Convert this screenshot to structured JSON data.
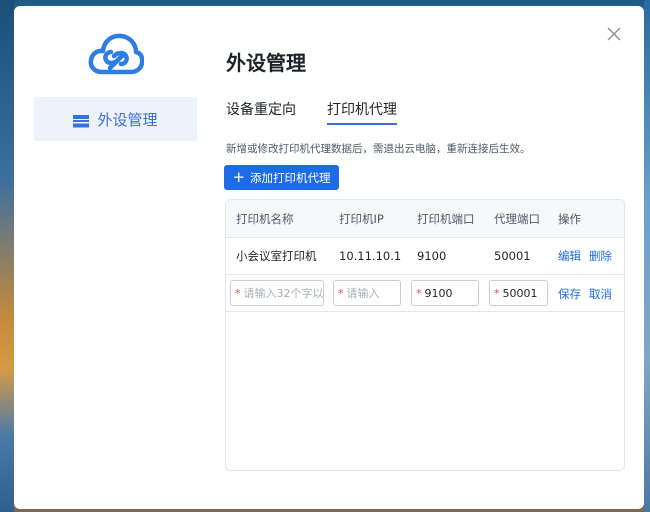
{
  "sidebar": {
    "items": [
      {
        "label": "外设管理",
        "icon": "printer-device-icon"
      }
    ]
  },
  "main": {
    "title": "外设管理",
    "tabs": [
      {
        "label": "设备重定向"
      },
      {
        "label": "打印机代理",
        "active": true
      }
    ],
    "hint": "新增或修改打印机代理数据后，需退出云电脑，重新连接后生效。",
    "add_button": "添加打印机代理"
  },
  "table": {
    "columns": [
      "打印机名称",
      "打印机IP",
      "打印机端口",
      "代理端口",
      "操作"
    ],
    "rows": [
      {
        "name": "小会议室打印机",
        "ip": "10.11.10.1",
        "port": "9100",
        "proxy_port": "50001",
        "edit": "编辑",
        "delete": "删除"
      }
    ],
    "edit_row": {
      "name_placeholder": "请输入32个字以",
      "ip_placeholder": "请输入",
      "port_value": "9100",
      "proxy_port_value": "50001",
      "save": "保存",
      "cancel": "取消"
    }
  },
  "colors": {
    "accent": "#1e6be6",
    "nav_bg": "#eef2fb",
    "required": "#e5484d"
  }
}
